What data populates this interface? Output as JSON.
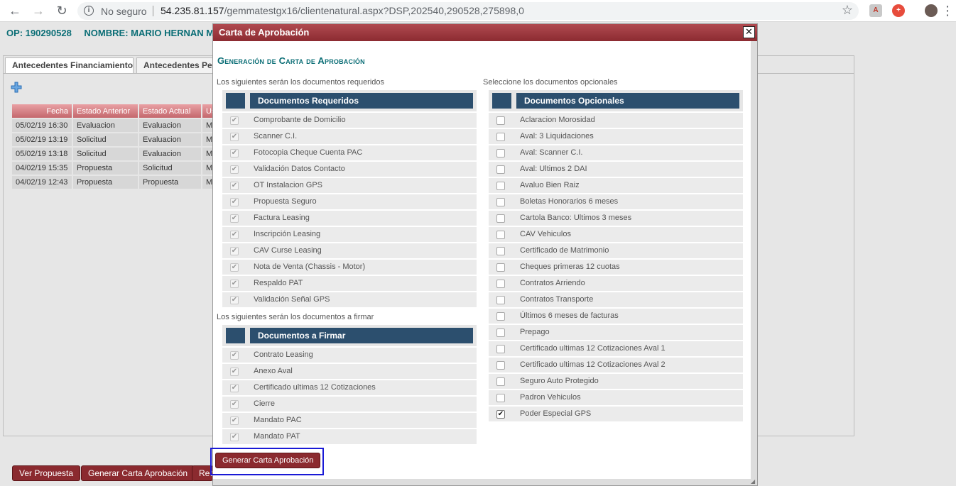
{
  "browser": {
    "security_text": "No seguro",
    "url_host": "54.235.81.157",
    "url_path": "/gemmatestgx16/clientenatural.aspx?DSP,202540,290528,275898,0"
  },
  "header": {
    "op_label": "OP: 190290528",
    "name_label": "NOMBRE: MARIO HERNAN ME"
  },
  "tabs": [
    {
      "label": "Antecedentes Financiamiento"
    },
    {
      "label": "Antecedentes Per"
    }
  ],
  "history": {
    "columns": [
      "Fecha",
      "Estado Anterior",
      "Estado Actual",
      "Us"
    ],
    "rows": [
      [
        "05/02/19 16:30",
        "Evaluacion",
        "Evaluacion",
        "MA"
      ],
      [
        "05/02/19 13:19",
        "Solicitud",
        "Evaluacion",
        "MA"
      ],
      [
        "05/02/19 13:18",
        "Solicitud",
        "Evaluacion",
        "MA"
      ],
      [
        "04/02/19 15:35",
        "Propuesta",
        "Solicitud",
        "MA"
      ],
      [
        "04/02/19 12:43",
        "Propuesta",
        "Propuesta",
        "MA"
      ]
    ]
  },
  "page_buttons": {
    "ver_propuesta": "Ver Propuesta",
    "generar_carta": "Generar Carta Aprobación",
    "third": "Rec"
  },
  "modal": {
    "title": "Carta de Aprobación",
    "close": "✕",
    "heading": "Generación de Carta de Aprobación",
    "required_caption": "Los siguientes serán los documentos requeridos",
    "required_header": "Documentos Requeridos",
    "required_docs": [
      {
        "label": "Comprobante de Domicilio",
        "checked": true
      },
      {
        "label": "Scanner C.I.",
        "checked": true
      },
      {
        "label": "Fotocopia Cheque Cuenta PAC",
        "checked": true
      },
      {
        "label": "Validación Datos Contacto",
        "checked": true
      },
      {
        "label": "OT Instalacion GPS",
        "checked": true
      },
      {
        "label": "Propuesta Seguro",
        "checked": true
      },
      {
        "label": "Factura Leasing",
        "checked": true
      },
      {
        "label": "Inscripción Leasing",
        "checked": true
      },
      {
        "label": "CAV Curse Leasing",
        "checked": true
      },
      {
        "label": "Nota de Venta (Chassis - Motor)",
        "checked": true
      },
      {
        "label": "Respaldo PAT",
        "checked": true
      },
      {
        "label": "Validación Señal GPS",
        "checked": true
      }
    ],
    "sign_caption": "Los siguientes serán los documentos a firmar",
    "sign_header": "Documentos a Firmar",
    "sign_docs": [
      {
        "label": "Contrato Leasing",
        "checked": true
      },
      {
        "label": "Anexo Aval",
        "checked": true
      },
      {
        "label": "Certificado ultimas 12 Cotizaciones",
        "checked": true
      },
      {
        "label": "Cierre",
        "checked": true
      },
      {
        "label": "Mandato PAC",
        "checked": true
      },
      {
        "label": "Mandato PAT",
        "checked": true
      }
    ],
    "optional_caption": "Seleccione los documentos opcionales",
    "optional_header": "Documentos Opcionales",
    "optional_docs": [
      {
        "label": "Aclaracion Morosidad",
        "checked": false
      },
      {
        "label": "Aval: 3 Liquidaciones",
        "checked": false
      },
      {
        "label": "Aval: Scanner C.I.",
        "checked": false
      },
      {
        "label": "Aval: Ultimos 2 DAI",
        "checked": false
      },
      {
        "label": "Avaluo Bien Raiz",
        "checked": false
      },
      {
        "label": "Boletas Honorarios 6 meses",
        "checked": false
      },
      {
        "label": "Cartola Banco: Ultimos 3 meses",
        "checked": false
      },
      {
        "label": "CAV Vehiculos",
        "checked": false
      },
      {
        "label": "Certificado de Matrimonio",
        "checked": false
      },
      {
        "label": "Cheques primeras 12 cuotas",
        "checked": false
      },
      {
        "label": "Contratos Arriendo",
        "checked": false
      },
      {
        "label": "Contratos Transporte",
        "checked": false
      },
      {
        "label": "Últimos 6 meses de facturas",
        "checked": false
      },
      {
        "label": "Prepago",
        "checked": false
      },
      {
        "label": "Certificado ultimas 12 Cotizaciones Aval 1",
        "checked": false
      },
      {
        "label": "Certificado ultimas 12 Cotizaciones Aval 2",
        "checked": false
      },
      {
        "label": "Seguro Auto Protegido",
        "checked": false
      },
      {
        "label": "Padron Vehiculos",
        "checked": false
      },
      {
        "label": "Poder Especial GPS",
        "checked": true
      }
    ],
    "generate_button": "Generar Carta Aprobación"
  },
  "colors": {
    "accent_teal": "#0b6e76",
    "header_navy": "#2c4f6e",
    "button_red": "#8b2a2f",
    "highlight_blue": "#1a1ad6"
  }
}
